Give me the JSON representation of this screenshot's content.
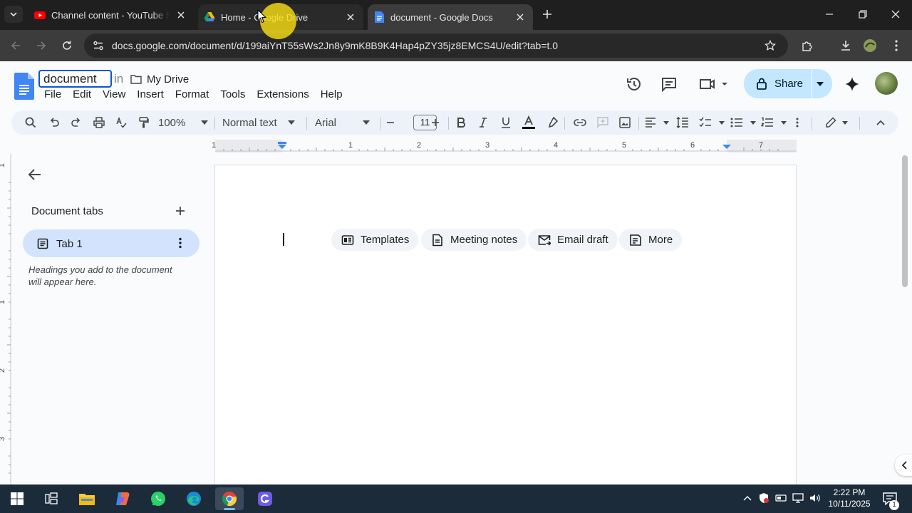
{
  "browser": {
    "tabs": [
      {
        "title": "Channel content - YouTube Studio",
        "favicon": "youtube-icon"
      },
      {
        "title": "Home - Google Drive",
        "favicon": "google-drive-icon"
      },
      {
        "title": "document - Google Docs",
        "favicon": "google-docs-icon"
      }
    ],
    "url": "docs.google.com/document/d/199aiYnT55sWs2Jn8y9mK8B9K4Hap4pZY35jz8EMCS4U/edit?tab=t.0"
  },
  "docs": {
    "title": "document",
    "title_in": "in",
    "folder": "My Drive",
    "menu": [
      "File",
      "Edit",
      "View",
      "Insert",
      "Format",
      "Tools",
      "Extensions",
      "Help"
    ],
    "share_label": "Share",
    "toolbar": {
      "zoom": "100%",
      "style": "Normal text",
      "font": "Arial",
      "font_size": "11"
    },
    "ruler_numbers": [
      "1",
      "1",
      "2",
      "3",
      "4",
      "5",
      "6",
      "7"
    ],
    "left_ruler_numbers": [
      "1",
      "1",
      "2",
      "3"
    ],
    "left_panel": {
      "title": "Document tabs",
      "tab_label": "Tab 1",
      "hint": "Headings you add to the document will appear here."
    },
    "chips": [
      {
        "label": "Templates",
        "icon": "template-icon"
      },
      {
        "label": "Meeting notes",
        "icon": "document-icon"
      },
      {
        "label": "Email draft",
        "icon": "email-icon"
      },
      {
        "label": "More",
        "icon": "more-doc-icon"
      }
    ]
  },
  "taskbar": {
    "time": "2:22 PM",
    "date": "10/11/2025",
    "notification_count": "1"
  },
  "colors": {
    "accent": "#0b57d0",
    "share_bg": "#c2e7ff",
    "toolbar_bg": "#edf2fa",
    "tab_selected": "#d3e3fd"
  }
}
